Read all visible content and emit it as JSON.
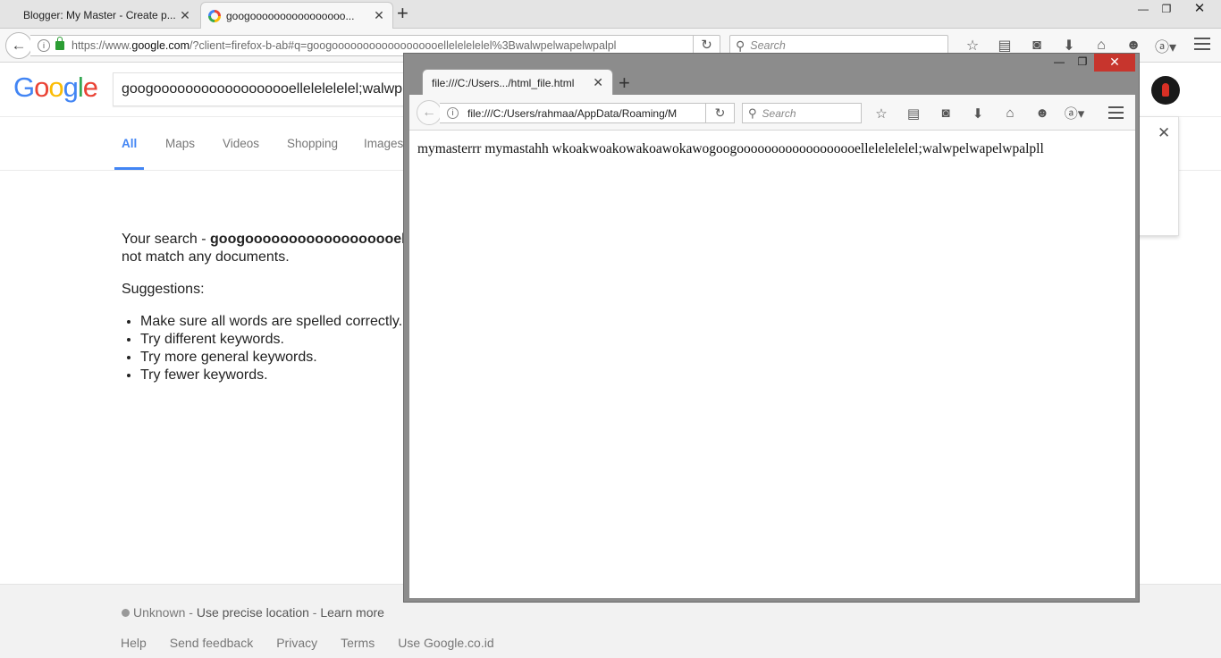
{
  "browser": {
    "tabs": [
      {
        "label": "Blogger: My Master - Create p...",
        "active": false
      },
      {
        "label": "googoooooooooooooooo...",
        "active": true
      }
    ],
    "window_controls": {
      "minimize": "—",
      "maximize": "❐",
      "close": "✕"
    },
    "url": {
      "prefix": "https://www.",
      "host": "google.com",
      "rest": "/?client=firefox-b-ab#q=googoooooooooooooooooellelelelelel%3Bwalwpelwapelwpalpl"
    },
    "search_placeholder": "Search",
    "toolbar_icons": [
      "star-icon",
      "reading-list-icon",
      "pocket-icon",
      "download-icon",
      "home-icon",
      "emoji-icon",
      "adblock-icon"
    ]
  },
  "google": {
    "logo": [
      "G",
      "o",
      "o",
      "g",
      "l",
      "e"
    ],
    "query": "googoooooooooooooooooellelelelelel;walwp",
    "tabs": [
      "All",
      "Maps",
      "Videos",
      "Shopping",
      "Images"
    ],
    "results": {
      "lead": "Your search - ",
      "query_shown": "googoooooooooooooooooelle",
      "no_match": "not match any documents.",
      "suggestions_heading": "Suggestions:",
      "suggestions": [
        "Make sure all words are spelled correctly.",
        "Try different keywords.",
        "Try more general keywords.",
        "Try fewer keywords."
      ]
    },
    "footer": {
      "location_status": "Unknown",
      "use_precise": "Use precise location",
      "learn_more": "Learn more",
      "separator": " - ",
      "links": [
        "Help",
        "Send feedback",
        "Privacy",
        "Terms",
        "Use Google.co.id"
      ]
    }
  },
  "popup_window": {
    "tab_label": "file:///C:/Users.../html_file.html",
    "url": "file:///C:/Users/rahmaa/AppData/Roaming/M",
    "search_placeholder": "Search",
    "content": "mymasterrr mymastahh wkoakwoakowakoawokawogoogoooooooooooooooooellelelelelel;walwpelwapelwpalpll"
  },
  "colors": {
    "google_blue": "#4285f4",
    "google_red": "#ea4335",
    "google_yellow": "#fbbc05",
    "google_green": "#34a853",
    "close_red": "#c7352d"
  }
}
